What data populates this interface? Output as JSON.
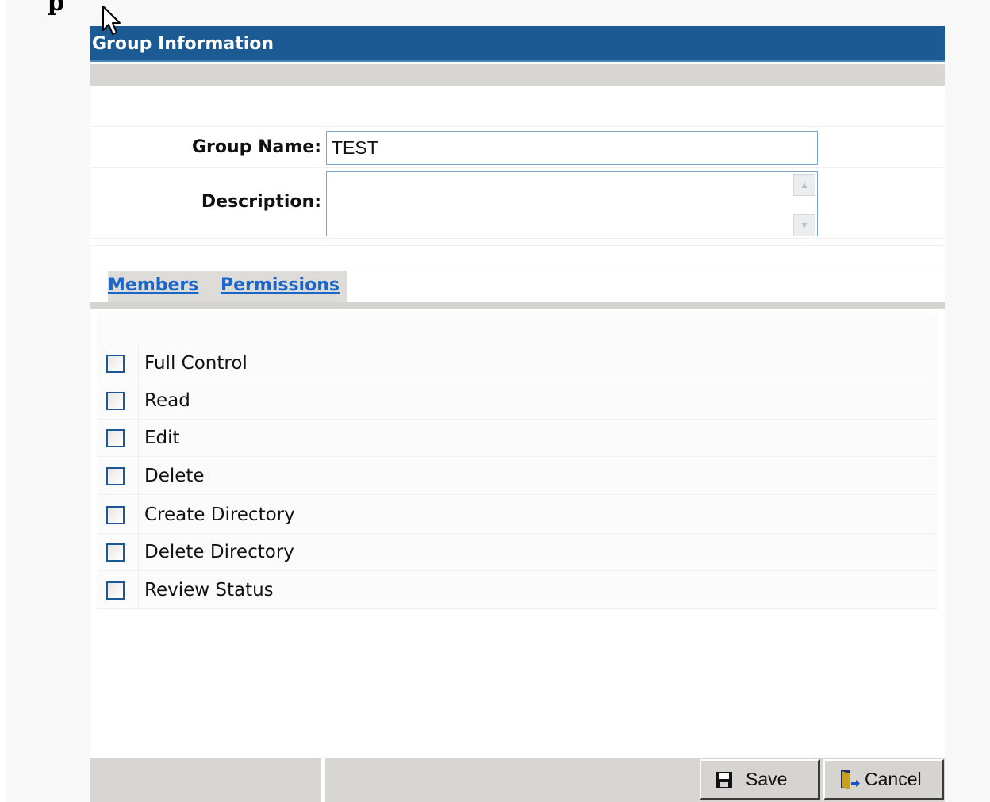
{
  "page": {
    "partial_heading": "p"
  },
  "header": {
    "title": "Group Information"
  },
  "form": {
    "group_name_label": "Group Name:",
    "group_name_value": "TEST",
    "description_label": "Description:",
    "description_value": ""
  },
  "tabs": [
    {
      "label": "Members"
    },
    {
      "label": "Permissions"
    }
  ],
  "permissions": [
    {
      "label": "Full Control",
      "checked": false
    },
    {
      "label": "Read",
      "checked": false
    },
    {
      "label": "Edit",
      "checked": false
    },
    {
      "label": "Delete",
      "checked": false
    },
    {
      "label": "Create Directory",
      "checked": false
    },
    {
      "label": "Delete Directory",
      "checked": false
    },
    {
      "label": "Review Status",
      "checked": false
    }
  ],
  "footer": {
    "save_label": "Save",
    "cancel_label": "Cancel"
  },
  "colors": {
    "title_bar": "#1c5a93",
    "link": "#1b66c9",
    "strip": "#d8d6d2"
  },
  "icons": {
    "save": "floppy-disk-icon",
    "cancel": "exit-door-icon",
    "cursor": "mouse-pointer-icon"
  }
}
